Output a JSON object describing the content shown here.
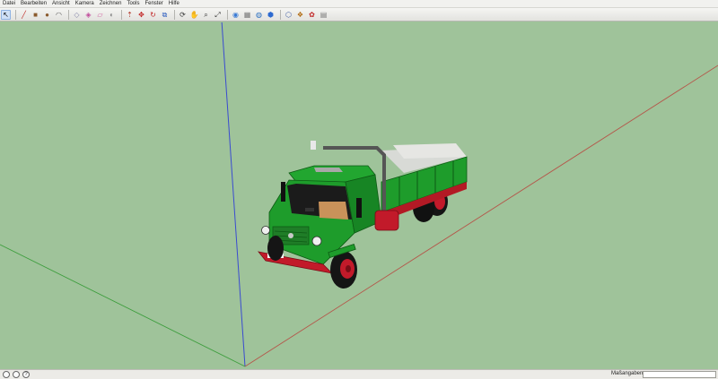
{
  "menu": {
    "items": [
      "Datei",
      "Bearbeiten",
      "Ansicht",
      "Kamera",
      "Zeichnen",
      "Tools",
      "Fenster",
      "Hilfe"
    ]
  },
  "toolbar": {
    "tools": [
      {
        "name": "select-tool-icon",
        "glyph": "↖"
      },
      {
        "name": "eraser-tool-icon",
        "glyph": "▰"
      },
      {
        "name": "pencil-line-tool-icon",
        "glyph": "╱"
      },
      {
        "name": "rectangle-tool-icon",
        "glyph": "■"
      },
      {
        "name": "circle-tool-icon",
        "glyph": "●"
      },
      {
        "name": "arc-tool-icon",
        "glyph": "◠"
      },
      {
        "name": "make-component-icon",
        "glyph": "◇"
      },
      {
        "name": "paint-bucket-icon",
        "glyph": "◈"
      },
      {
        "name": "eraser-icon",
        "glyph": "▱"
      },
      {
        "name": "tape-measure-icon",
        "glyph": "◐"
      },
      {
        "name": "push-pull-tool-icon",
        "glyph": "⇡"
      },
      {
        "name": "move-tool-icon",
        "glyph": "✥"
      },
      {
        "name": "rotate-tool-icon",
        "glyph": "↻"
      },
      {
        "name": "offset-tool-icon",
        "glyph": "⧉"
      },
      {
        "name": "orbit-tool-icon",
        "glyph": "⟳"
      },
      {
        "name": "pan-tool-icon",
        "glyph": "✋"
      },
      {
        "name": "zoom-tool-icon",
        "glyph": "⌕"
      },
      {
        "name": "zoom-extents-icon",
        "glyph": "⤢"
      },
      {
        "name": "get-models-icon",
        "glyph": "⬢"
      },
      {
        "name": "share-model-icon",
        "glyph": "⬡"
      },
      {
        "name": "add-location-icon",
        "glyph": "◉"
      },
      {
        "name": "toggle-terrain-icon",
        "glyph": "▦"
      },
      {
        "name": "preview-google-earth-icon",
        "glyph": "◍"
      },
      {
        "name": "component-browser-icon",
        "glyph": "❖"
      },
      {
        "name": "extension-warehouse-icon",
        "glyph": "✿"
      },
      {
        "name": "send-to-layout-icon",
        "glyph": "▤"
      }
    ]
  },
  "status": {
    "icons": [
      "geo-location-icon",
      "credits-icon",
      "help-icon"
    ],
    "help_glyph": "?",
    "vcb_label": "Maßangaben",
    "vcb_value": ""
  },
  "scene": {
    "background": "#9fc39a",
    "axis_red": "#b5564a",
    "axis_green": "#3e9e3e",
    "axis_blue": "#3a4bd0",
    "truck_green": "#1e9c2b",
    "truck_red": "#c21a2a"
  }
}
